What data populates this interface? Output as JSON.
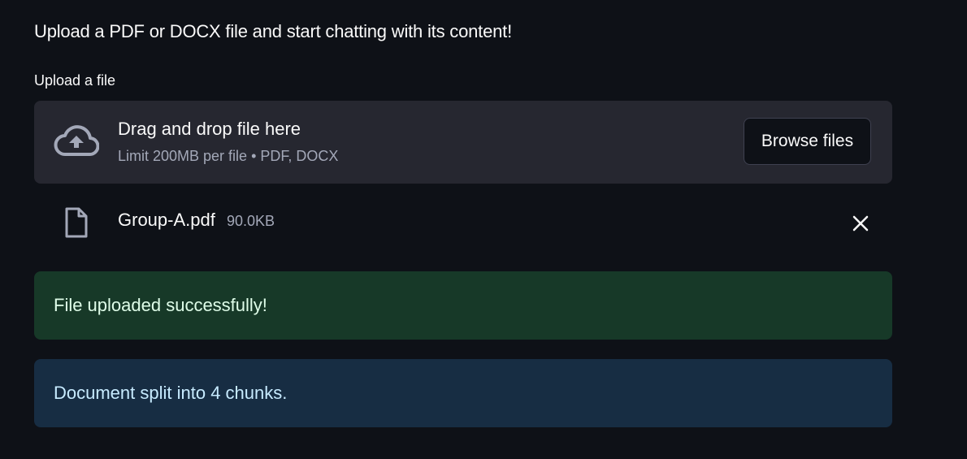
{
  "intro_text": "Upload a PDF or DOCX file and start chatting with its content!",
  "uploader": {
    "label": "Upload a file",
    "drop_text": "Drag and drop file here",
    "limit_text": "Limit 200MB per file • PDF, DOCX",
    "browse_label": "Browse files",
    "icon": "cloud-upload-icon"
  },
  "uploaded_file": {
    "name": "Group-A.pdf",
    "size": "90.0KB",
    "icon": "file-icon",
    "remove_icon": "close-icon"
  },
  "alerts": {
    "success": "File uploaded successfully!",
    "info": "Document split into 4 chunks."
  },
  "colors": {
    "background": "#0e1117",
    "dropzone": "#262730",
    "success_bg": "#173928",
    "info_bg": "#172d43"
  }
}
